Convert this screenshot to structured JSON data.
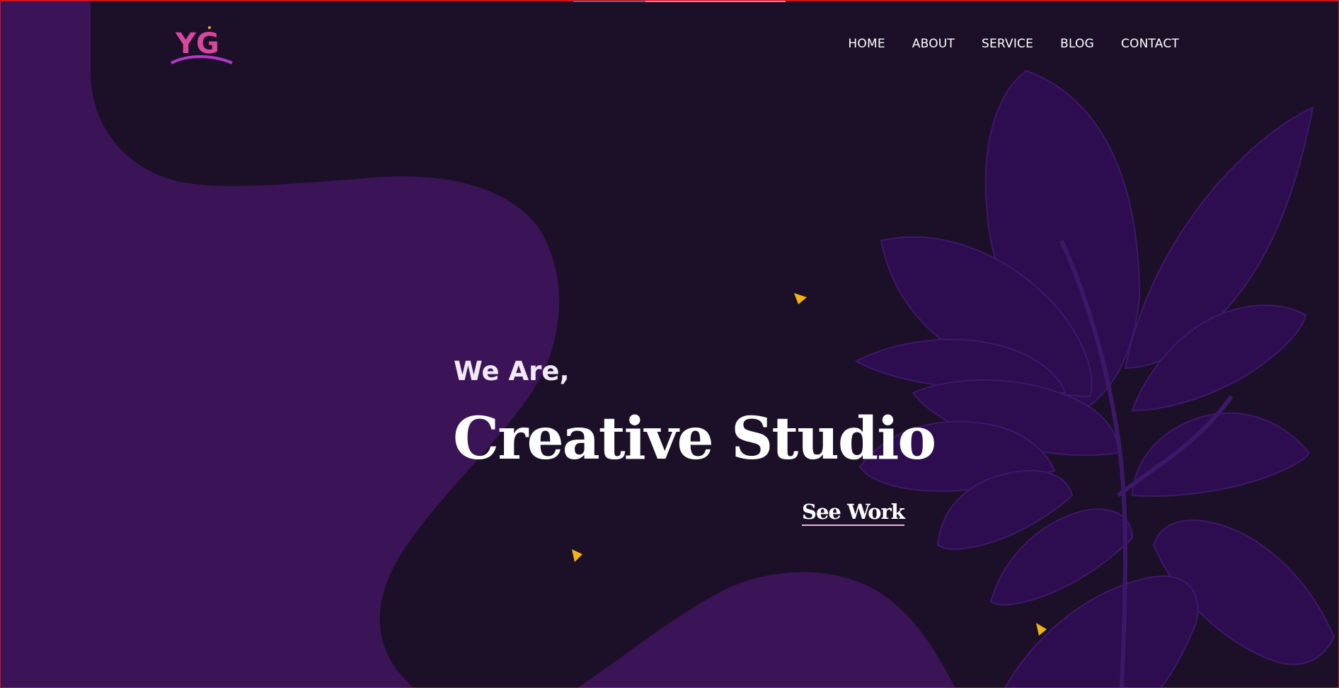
{
  "header": {
    "logo_text": "YG",
    "nav": [
      "HOME",
      "ABOUT",
      "SERVICE",
      "BLOG",
      "CONTACT"
    ]
  },
  "hero": {
    "subtitle": "We Are,",
    "title": "Creative Studio",
    "cta": "See Work"
  },
  "scroll_progress": 0.66,
  "colors": {
    "background": "#1b1027",
    "blob": "#3a1456",
    "leaf": "#2e0e52",
    "accent_triangle": "#f2b315",
    "cta_underline": "#e7b7d9",
    "frame_border": "#d0121f"
  },
  "icons": [
    "logo-mark",
    "triangle-shape",
    "plant-leaves-illustration"
  ]
}
